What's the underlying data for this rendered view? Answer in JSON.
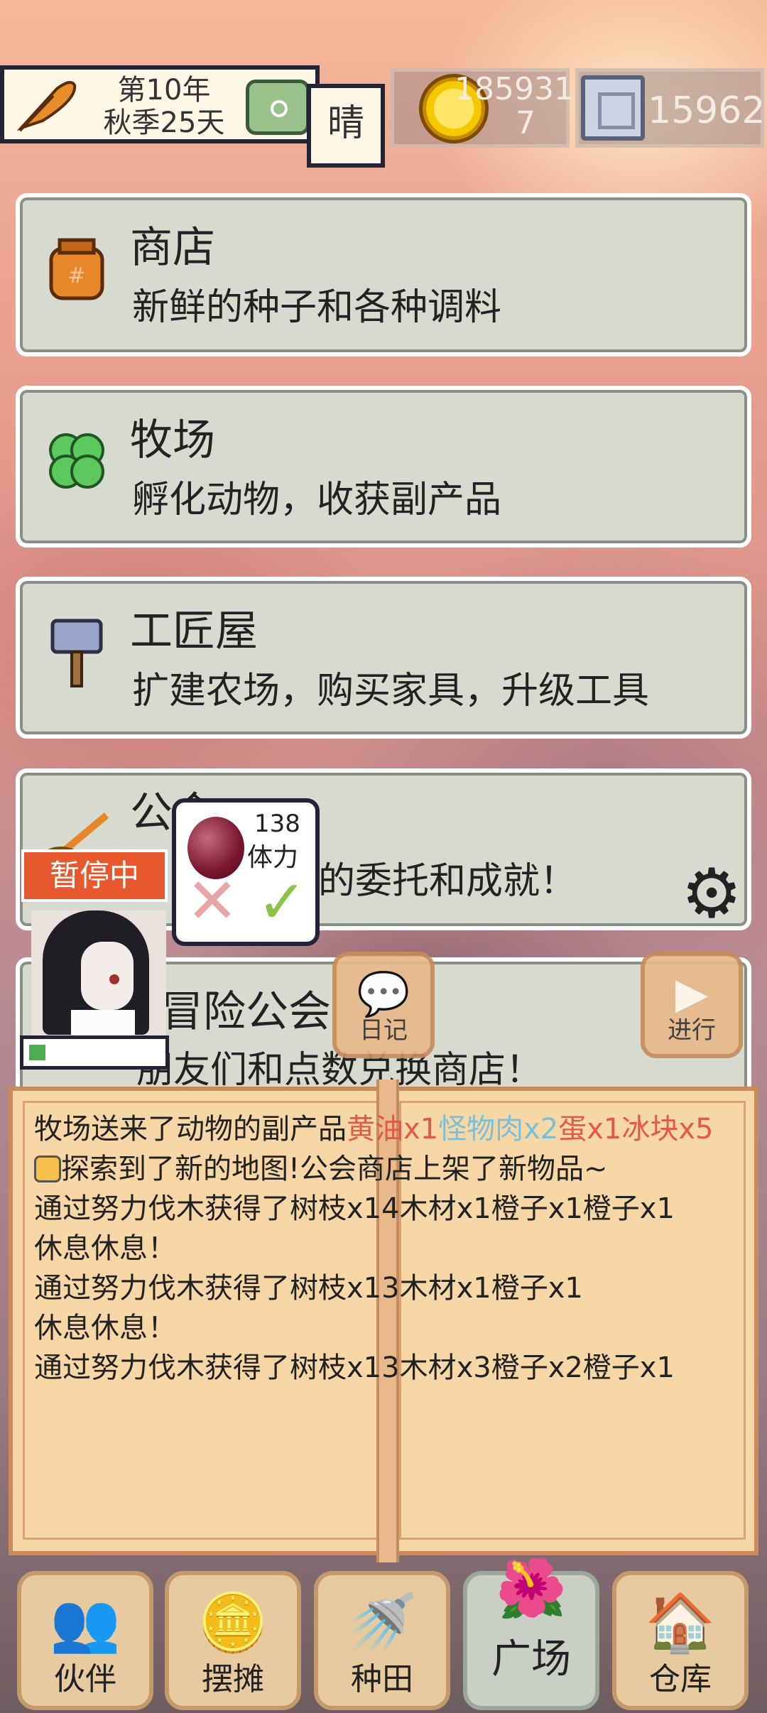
{
  "top_bar": {
    "year": "第10年",
    "season_day": "秋季25天",
    "weather": "晴",
    "gold_line1": "185931",
    "gold_line2": "7",
    "silver": "15962"
  },
  "menu": [
    {
      "title": "商店",
      "desc": "新鲜的种子和各种调料",
      "icon": "seed-bag-icon"
    },
    {
      "title": "牧场",
      "desc": "孵化动物，收获副产品",
      "icon": "clover-icon"
    },
    {
      "title": "工匠屋",
      "desc": "扩建农场，购买家具，升级工具",
      "icon": "hammer-icon"
    },
    {
      "title": "公会",
      "desc": "的委托和成就！",
      "icon": "broom-icon"
    },
    {
      "title": "冒险公会",
      "desc": "朋友们和点数兑换商店！",
      "icon": ""
    }
  ],
  "overlay": {
    "pause": "暂停中",
    "stamina_value": "138",
    "stamina_label": "体力",
    "progress": 0.12,
    "diary": "日记",
    "go": "进行"
  },
  "log": [
    {
      "parts": [
        {
          "t": "牧场送来了动物的副产品",
          "c": ""
        },
        {
          "t": "黄油x1",
          "c": "red"
        },
        {
          "t": "怪物肉x2",
          "c": "blue"
        },
        {
          "t": "蛋x1",
          "c": "red"
        },
        {
          "t": "冰块x5",
          "c": "red"
        }
      ]
    },
    {
      "parts": [
        {
          "t": "探索到了新的地图!公会商店上架了新物品~",
          "c": ""
        }
      ],
      "icon": true
    },
    {
      "parts": [
        {
          "t": "通过努力伐木获得了树枝x14木材x1橙子x1橙子x1",
          "c": ""
        }
      ]
    },
    {
      "parts": [
        {
          "t": "休息休息！",
          "c": ""
        }
      ]
    },
    {
      "parts": [
        {
          "t": "通过努力伐木获得了树枝x13木材x1橙子x1",
          "c": ""
        }
      ]
    },
    {
      "parts": [
        {
          "t": "休息休息！",
          "c": ""
        }
      ]
    },
    {
      "parts": [
        {
          "t": "通过努力伐木获得了树枝x13木材x3橙子x2橙子x1",
          "c": ""
        }
      ]
    }
  ],
  "nav": [
    {
      "label": "伙伴",
      "icon": "people-icon",
      "glyph": "👥",
      "active": false
    },
    {
      "label": "摆摊",
      "icon": "coins-icon",
      "glyph": "🪙",
      "active": false
    },
    {
      "label": "种田",
      "icon": "watering-can-icon",
      "glyph": "🚿",
      "active": false
    },
    {
      "label": "广场",
      "icon": "flower-icon",
      "glyph": "🌺",
      "active": true
    },
    {
      "label": "仓库",
      "icon": "house-icon",
      "glyph": "🏠",
      "active": false
    }
  ]
}
